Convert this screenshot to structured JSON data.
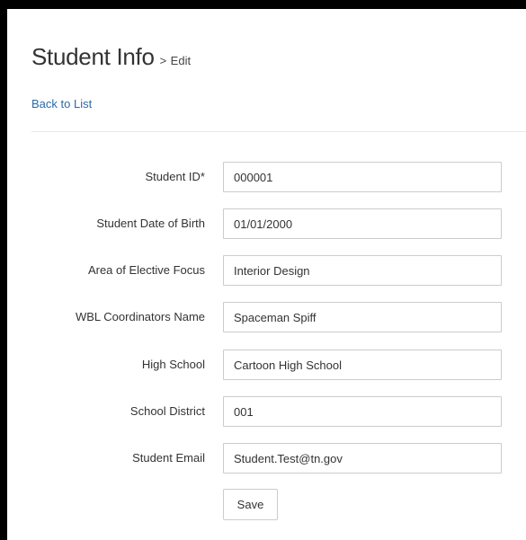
{
  "header": {
    "title": "Student Info",
    "separator": ">",
    "subtitle": "Edit"
  },
  "nav": {
    "back_link": "Back to List"
  },
  "form": {
    "fields": [
      {
        "label": "Student ID*",
        "value": "000001"
      },
      {
        "label": "Student Date of Birth",
        "value": "01/01/2000"
      },
      {
        "label": "Area of Elective Focus",
        "value": "Interior Design"
      },
      {
        "label": "WBL Coordinators Name",
        "value": "Spaceman Spiff"
      },
      {
        "label": "High School",
        "value": "Cartoon High School"
      },
      {
        "label": "School District",
        "value": "001"
      },
      {
        "label": "Student Email",
        "value": "Student.Test@tn.gov"
      }
    ],
    "save_label": "Save"
  },
  "colors": {
    "link": "#2a6ba8",
    "border": "#cccccc",
    "text": "#333333"
  }
}
